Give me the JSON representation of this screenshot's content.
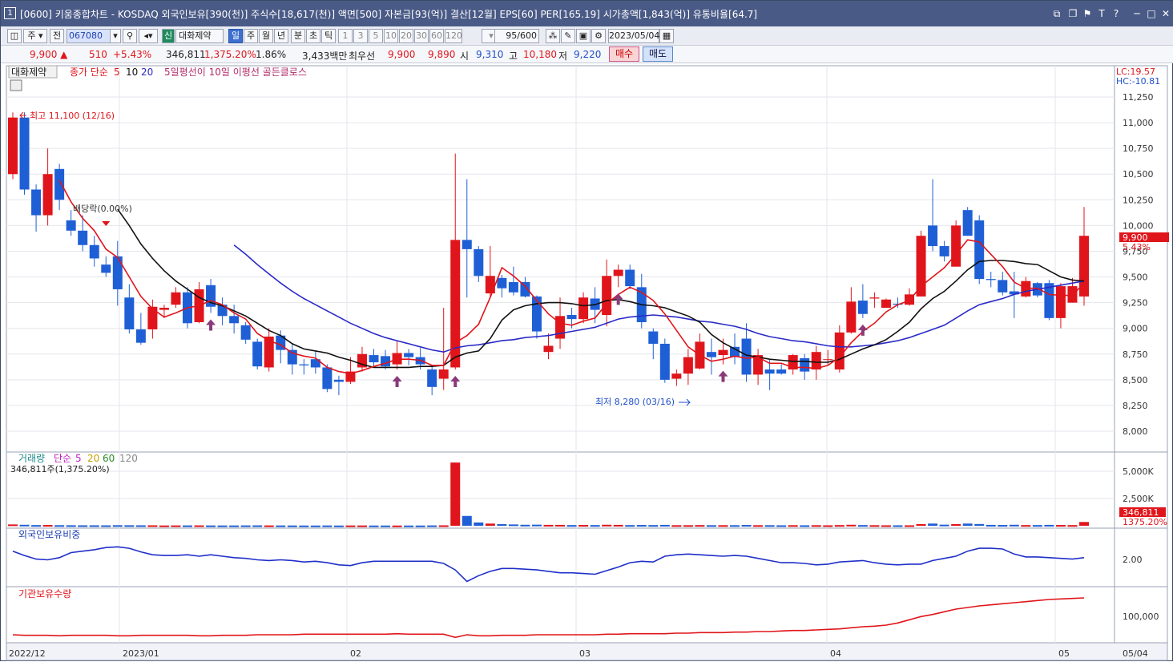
{
  "window": {
    "number": "1",
    "title": "[0600] 키움종합차트 - KOSDAQ 외국인보유[390(천)] 주식수[18,617(천)] 액면[500] 자본금[93(억)] 결산[12월] EPS[60] PER[165.19] 시가총액[1,843(억)] 유통비율[64.7]"
  },
  "toolbar": {
    "period_label": "주",
    "prev_label": "전",
    "code": "067080",
    "badge": "신",
    "stock_name": "대화제약",
    "periods": [
      "일",
      "주",
      "월",
      "년",
      "분",
      "초",
      "틱"
    ],
    "minutes": [
      "1",
      "3",
      "5",
      "10",
      "20",
      "30",
      "60",
      "120"
    ],
    "count": "95",
    "count_total": "/600",
    "date": "2023/05/04"
  },
  "quote": {
    "price": "9,900 ▲",
    "change": "510",
    "change_pct": "+5.43%",
    "volume": "346,811",
    "volume_ratio": "1,375.20%",
    "turnover": "1.86%",
    "amount": "3,433백만",
    "best_label": "최우선",
    "best_ask": "9,900",
    "best_bid": "9,890",
    "open_label": "시",
    "open": "9,310",
    "high_label": "고",
    "high": "10,180",
    "low_label": "저",
    "low": "9,220",
    "buy_label": "매수",
    "sell_label": "매도"
  },
  "price_panel": {
    "stock_tag": "대화제약",
    "legend_prefix": "종가 단순",
    "ma_periods": [
      "5",
      "10",
      "20"
    ],
    "signal_label": "5일평선이 10일 이평선 골든클로스",
    "lc": "LC:19.57",
    "hc": "HC:-10.81",
    "high_note": "최고 11,100 (12/16)",
    "low_note": "최저 8,280 (03/16)",
    "drop_note": "배당락(0.00%)",
    "current_price_tag": "9,900",
    "current_pct_tag": "5.43%",
    "y_ticks": [
      "11,250",
      "11,000",
      "10,750",
      "10,500",
      "10,250",
      "10,000",
      "9,750",
      "9,500",
      "9,250",
      "9,000",
      "8,750",
      "8,500",
      "8,250",
      "8,000"
    ]
  },
  "volume_panel": {
    "legend_prefix": "거래량",
    "legend_simple": "단순",
    "ma_periods": [
      "5",
      "20",
      "60",
      "120"
    ],
    "current_label": "346,811주(1,375.20%)",
    "y_ticks": [
      "5,000K",
      "2,500K"
    ],
    "current_tag": "346,811",
    "current_pct_tag": "1375.20%"
  },
  "foreign_panel": {
    "title": "외국인보유비중",
    "y_tick": "2.00"
  },
  "inst_panel": {
    "title": "기관보유수량",
    "y_tick": "100,000"
  },
  "x_axis": {
    "labels": [
      "2022/12",
      "2023/01",
      "02",
      "03",
      "04",
      "05"
    ],
    "right_label": "05/04"
  },
  "colors": {
    "up": "#e0151b",
    "down": "#1f5fd6",
    "ma5": "#e0151b",
    "ma10": "#111111",
    "ma20": "#2a2ac8",
    "title_bar": "#4a5a86"
  },
  "chart_data": {
    "type": "candlestick",
    "ohlc": [
      [
        10500,
        11050,
        10450,
        11100
      ],
      [
        11050,
        10350,
        10300,
        11100
      ],
      [
        10350,
        10100,
        9940,
        10400
      ],
      [
        10100,
        10500,
        10000,
        10750
      ],
      [
        10550,
        10250,
        10150,
        10600
      ],
      [
        10050,
        9950,
        9900,
        10150
      ],
      [
        9950,
        9810,
        9750,
        10100
      ],
      [
        9810,
        9680,
        9600,
        9900
      ],
      [
        9620,
        9540,
        9500,
        9700
      ],
      [
        9700,
        9380,
        9220,
        9850
      ],
      [
        9300,
        8990,
        8950,
        9430
      ],
      [
        8990,
        8860,
        8840,
        9150
      ],
      [
        8990,
        9210,
        8900,
        9280
      ],
      [
        9180,
        9200,
        9100,
        9230
      ],
      [
        9230,
        9350,
        9200,
        9400
      ],
      [
        9350,
        9050,
        9000,
        9400
      ],
      [
        9060,
        9380,
        9050,
        9450
      ],
      [
        9420,
        9210,
        9150,
        9480
      ],
      [
        9230,
        9120,
        9030,
        9300
      ],
      [
        9120,
        9050,
        8950,
        9230
      ],
      [
        9030,
        8890,
        8850,
        9060
      ],
      [
        8870,
        8630,
        8600,
        8900
      ],
      [
        8620,
        8920,
        8580,
        9000
      ],
      [
        8930,
        8790,
        8660,
        8980
      ],
      [
        8790,
        8650,
        8550,
        8850
      ],
      [
        8650,
        8640,
        8550,
        8700
      ],
      [
        8700,
        8620,
        8560,
        8780
      ],
      [
        8620,
        8410,
        8380,
        8650
      ],
      [
        8500,
        8480,
        8350,
        8540
      ],
      [
        8480,
        8580,
        8460,
        8720
      ],
      [
        8620,
        8750,
        8580,
        8820
      ],
      [
        8740,
        8670,
        8630,
        8800
      ],
      [
        8730,
        8630,
        8600,
        8790
      ],
      [
        8650,
        8760,
        8600,
        8880
      ],
      [
        8760,
        8720,
        8640,
        8800
      ],
      [
        8720,
        8650,
        8600,
        8810
      ],
      [
        8600,
        8430,
        8350,
        8640
      ],
      [
        8510,
        8600,
        8400,
        9200
      ],
      [
        8620,
        9860,
        8600,
        10700
      ],
      [
        9860,
        9770,
        9300,
        10450
      ],
      [
        9770,
        9510,
        9450,
        9800
      ],
      [
        9340,
        9510,
        9300,
        9800
      ],
      [
        9490,
        9390,
        9300,
        9520
      ],
      [
        9450,
        9350,
        9320,
        9600
      ],
      [
        9450,
        9310,
        9300,
        9500
      ],
      [
        9310,
        8970,
        8900,
        9320
      ],
      [
        8770,
        8830,
        8700,
        8950
      ],
      [
        8900,
        9120,
        8800,
        9300
      ],
      [
        9130,
        9090,
        9000,
        9200
      ],
      [
        9090,
        9300,
        9050,
        9350
      ],
      [
        9290,
        9180,
        9050,
        9400
      ],
      [
        9130,
        9510,
        9020,
        9670
      ],
      [
        9510,
        9570,
        9400,
        9620
      ],
      [
        9570,
        9410,
        9380,
        9620
      ],
      [
        9400,
        9060,
        9000,
        9530
      ],
      [
        8970,
        8850,
        8700,
        9000
      ],
      [
        8850,
        8500,
        8470,
        8900
      ],
      [
        8510,
        8560,
        8440,
        8600
      ],
      [
        8560,
        8720,
        8450,
        8800
      ],
      [
        8610,
        8870,
        8600,
        8950
      ],
      [
        8770,
        8720,
        8550,
        8900
      ],
      [
        8740,
        8790,
        8650,
        8900
      ],
      [
        8820,
        8720,
        8650,
        8950
      ],
      [
        8900,
        8550,
        8480,
        9050
      ],
      [
        8550,
        8740,
        8450,
        8800
      ],
      [
        8600,
        8560,
        8400,
        8700
      ],
      [
        8600,
        8560,
        8550,
        8650
      ],
      [
        8600,
        8740,
        8550,
        8750
      ],
      [
        8710,
        8580,
        8500,
        8750
      ],
      [
        8600,
        8770,
        8500,
        8830
      ],
      [
        8700,
        8700,
        8650,
        8790
      ],
      [
        8600,
        8960,
        8570,
        9030
      ],
      [
        8960,
        9260,
        8950,
        9400
      ],
      [
        9270,
        9140,
        9100,
        9430
      ],
      [
        9290,
        9300,
        9200,
        9350
      ],
      [
        9200,
        9280,
        9200,
        9290
      ],
      [
        9240,
        9230,
        9200,
        9300
      ],
      [
        9230,
        9330,
        9220,
        9390
      ],
      [
        9310,
        9900,
        9310,
        9950
      ],
      [
        10000,
        9800,
        9750,
        10450
      ],
      [
        9800,
        9700,
        9650,
        9850
      ],
      [
        9600,
        10000,
        9600,
        10050
      ],
      [
        10150,
        9900,
        9900,
        10180
      ],
      [
        10050,
        9480,
        9430,
        10100
      ],
      [
        9480,
        9470,
        9400,
        9550
      ],
      [
        9470,
        9350,
        9320,
        9550
      ],
      [
        9360,
        9330,
        9100,
        9550
      ],
      [
        9310,
        9460,
        9300,
        9500
      ],
      [
        9440,
        9320,
        9300,
        9450
      ],
      [
        9440,
        9100,
        9080,
        9470
      ],
      [
        9100,
        9410,
        9000,
        9440
      ],
      [
        9250,
        9410,
        9250,
        9490
      ],
      [
        9310,
        9900,
        9220,
        10180
      ]
    ],
    "ma5": [
      null,
      null,
      null,
      null,
      10440,
      10230,
      10070,
      9950,
      9770,
      9690,
      9500,
      9310,
      9190,
      9110,
      9150,
      9200,
      9220,
      9270,
      9230,
      9150,
      9090,
      8950,
      8880,
      8840,
      8760,
      8730,
      8710,
      8620,
      8580,
      8560,
      8590,
      8630,
      8660,
      8700,
      8700,
      8690,
      8640,
      8640,
      8860,
      8930,
      9040,
      9300,
      9590,
      9510,
      9410,
      9270,
      9140,
      9050,
      9030,
      9070,
      9100,
      9240,
      9330,
      9400,
      9350,
      9270,
      9140,
      8980,
      8820,
      8740,
      8680,
      8700,
      8730,
      8710,
      8720,
      8660,
      8660,
      8620,
      8620,
      8610,
      8640,
      8720,
      8860,
      8970,
      9050,
      9160,
      9230,
      9270,
      9410,
      9500,
      9590,
      9720,
      9860,
      9840,
      9720,
      9600,
      9450,
      9390,
      9390,
      9330,
      9320,
      9320,
      9440
    ],
    "ma10": [
      null,
      null,
      null,
      null,
      null,
      null,
      null,
      null,
      null,
      10160,
      10000,
      9820,
      9680,
      9560,
      9460,
      9380,
      9300,
      9250,
      9220,
      9170,
      9120,
      9050,
      8980,
      8930,
      8850,
      8800,
      8780,
      8760,
      8720,
      8690,
      8650,
      8620,
      8620,
      8620,
      8620,
      8630,
      8630,
      8640,
      8720,
      8760,
      8780,
      8900,
      9080,
      9180,
      9220,
      9240,
      9250,
      9250,
      9240,
      9220,
      9230,
      9270,
      9280,
      9260,
      9230,
      9220,
      9200,
      9160,
      9120,
      9060,
      8940,
      8860,
      8800,
      8740,
      8720,
      8700,
      8690,
      8680,
      8680,
      8670,
      8670,
      8700,
      8750,
      8800,
      8840,
      8890,
      8970,
      9060,
      9190,
      9290,
      9360,
      9460,
      9570,
      9650,
      9660,
      9660,
      9650,
      9630,
      9620,
      9560,
      9500,
      9470,
      9460
    ],
    "ma20": [
      null,
      null,
      null,
      null,
      null,
      null,
      null,
      null,
      null,
      null,
      null,
      null,
      null,
      null,
      null,
      null,
      null,
      null,
      null,
      9810,
      9720,
      9620,
      9530,
      9440,
      9360,
      9290,
      9230,
      9170,
      9110,
      9050,
      9000,
      8950,
      8910,
      8880,
      8850,
      8820,
      8790,
      8770,
      8810,
      8830,
      8840,
      8860,
      8880,
      8890,
      8910,
      8920,
      8930,
      8950,
      8970,
      8990,
      9010,
      9050,
      9090,
      9110,
      9120,
      9130,
      9120,
      9110,
      9090,
      9070,
      9060,
      9040,
      9020,
      8990,
      8950,
      8920,
      8900,
      8880,
      8870,
      8850,
      8830,
      8820,
      8820,
      8830,
      8840,
      8860,
      8880,
      8910,
      8950,
      8990,
      9030,
      9100,
      9170,
      9230,
      9260,
      9290,
      9330,
      9360,
      9380,
      9400,
      9420,
      9440,
      9460
    ],
    "volume": [
      120,
      90,
      60,
      70,
      50,
      45,
      40,
      40,
      35,
      50,
      45,
      40,
      40,
      25,
      30,
      30,
      35,
      25,
      25,
      25,
      30,
      35,
      30,
      25,
      25,
      20,
      20,
      25,
      20,
      25,
      25,
      20,
      20,
      20,
      20,
      20,
      30,
      40,
      5800,
      900,
      300,
      200,
      150,
      120,
      90,
      100,
      80,
      80,
      60,
      70,
      60,
      90,
      80,
      60,
      70,
      60,
      80,
      50,
      50,
      60,
      50,
      50,
      50,
      70,
      50,
      50,
      40,
      50,
      40,
      50,
      40,
      60,
      90,
      60,
      50,
      40,
      40,
      40,
      150,
      200,
      100,
      150,
      200,
      160,
      80,
      70,
      90,
      60,
      60,
      80,
      70,
      60,
      346.8
    ],
    "foreign_pct": [
      2.12,
      2.06,
      2.01,
      2.0,
      2.03,
      2.1,
      2.12,
      2.14,
      2.17,
      2.18,
      2.16,
      2.11,
      2.07,
      2.06,
      2.06,
      2.07,
      2.05,
      2.07,
      2.05,
      2.03,
      2.02,
      2.0,
      1.99,
      2.0,
      1.99,
      1.97,
      1.98,
      1.96,
      1.93,
      1.92,
      1.96,
      1.98,
      1.98,
      1.98,
      1.98,
      1.98,
      1.98,
      1.95,
      1.86,
      1.7,
      1.78,
      1.84,
      1.88,
      1.88,
      1.87,
      1.86,
      1.84,
      1.82,
      1.82,
      1.81,
      1.8,
      1.85,
      1.9,
      1.96,
      1.98,
      1.97,
      2.05,
      2.07,
      2.08,
      2.07,
      2.06,
      2.05,
      2.06,
      2.05,
      2.02,
      1.99,
      1.96,
      1.96,
      1.95,
      1.93,
      1.94,
      1.97,
      1.98,
      1.99,
      1.96,
      1.94,
      1.93,
      1.94,
      1.94,
      1.99,
      2.02,
      2.05,
      2.12,
      2.16,
      2.16,
      2.15,
      2.08,
      2.04,
      2.04,
      2.03,
      2.02,
      2.01,
      2.03
    ],
    "inst_qty": [
      62,
      61,
      61,
      61,
      60,
      61,
      61,
      61,
      61,
      60,
      60,
      61,
      61,
      61,
      61,
      61,
      60,
      60,
      61,
      61,
      61,
      62,
      62,
      62,
      62,
      63,
      63,
      63,
      63,
      63,
      63,
      63,
      63,
      64,
      63,
      63,
      63,
      63,
      57,
      62,
      60,
      60,
      61,
      61,
      61,
      62,
      62,
      62,
      62,
      62,
      62,
      63,
      63,
      64,
      64,
      64,
      64,
      65,
      65,
      66,
      66,
      66,
      67,
      67,
      68,
      68,
      69,
      70,
      70,
      71,
      72,
      73,
      75,
      77,
      78,
      80,
      84,
      90,
      96,
      100,
      105,
      110,
      113,
      116,
      118,
      120,
      122,
      124,
      126,
      128,
      129,
      130,
      131
    ]
  }
}
